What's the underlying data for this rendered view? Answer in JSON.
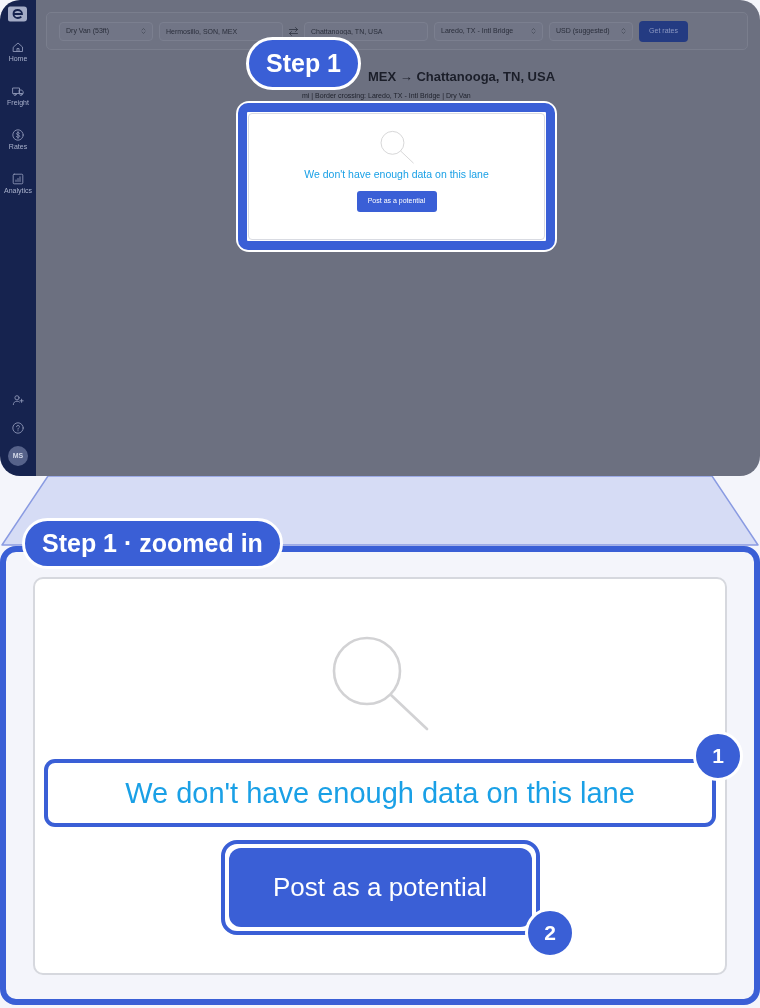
{
  "sidebar": {
    "items": [
      {
        "label": "Home"
      },
      {
        "label": "Freight"
      },
      {
        "label": "Rates"
      },
      {
        "label": "Analytics"
      }
    ],
    "avatar": "MS"
  },
  "filters": {
    "equipment": "Dry Van (53ft)",
    "origin": "Hermosillo, SON, MEX",
    "destination": "Chattanooga, TN, USA",
    "border_crossing": "Laredo, TX - Intl Bridge",
    "currency": "USD (suggested)",
    "submit": "Get rates"
  },
  "lane": {
    "title": "MEX → Chattanooga, TN, USA",
    "subtitle": "mi | Border crossing: Laredo, TX - Intl Bridge | Dry Van"
  },
  "empty_state": {
    "message": "We don't have enough data on this lane",
    "action": "Post as a potential"
  },
  "step_badge": "Step 1",
  "zoomed": {
    "badge": "Step 1 · zoomed in",
    "message": "We don't have enough data on this lane",
    "action": "Post as a potential",
    "callouts": [
      "1",
      "2"
    ]
  }
}
